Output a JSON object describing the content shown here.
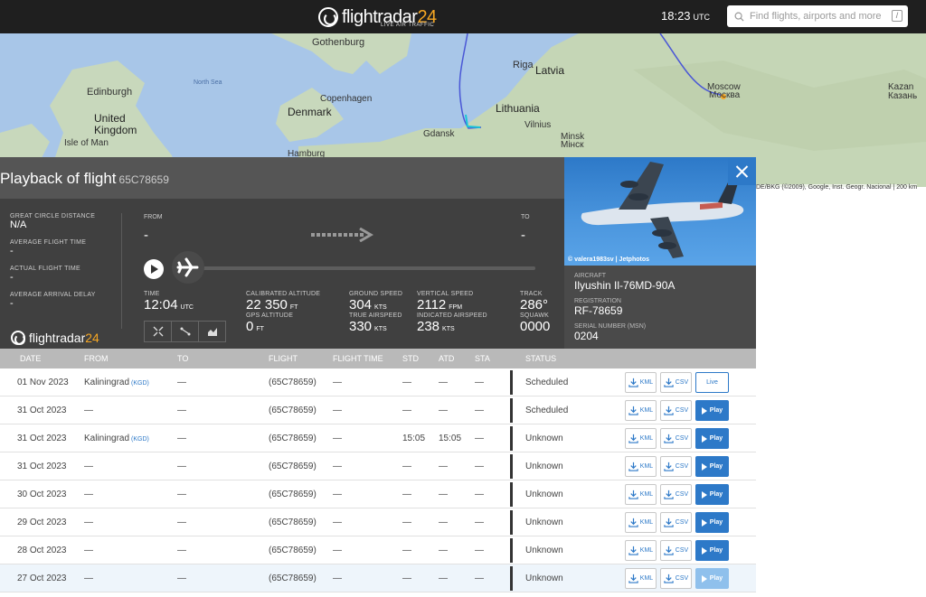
{
  "header": {
    "logo_text": "flightradar",
    "logo_num": "24",
    "logo_sub": "LIVE AIR TRAFFIC",
    "time": "18:23",
    "time_zone": "UTC",
    "search_placeholder": "Find flights, airports and more",
    "search_shortcut": "/"
  },
  "map": {
    "labels": [
      "Gothenburg",
      "Riga",
      "Latvia",
      "Edinburgh",
      "North Sea",
      "Denmark",
      "Copenhagen",
      "United Kingdom",
      "Isle of Man",
      "Lithuania",
      "Vilnius",
      "Gdansk",
      "Minsk",
      "Hamburg",
      "Moscow",
      "Москва",
      "Kazan",
      "Казань",
      "Мінск"
    ],
    "attribution": "DE/BKG (©2009), Google, Inst. Geogr. Nacional | 200 km"
  },
  "panel": {
    "title": "Playback of flight",
    "flight_id": "65C78659",
    "stats": [
      {
        "label": "GREAT CIRCLE DISTANCE",
        "value": "N/A"
      },
      {
        "label": "AVERAGE FLIGHT TIME",
        "value": "-"
      },
      {
        "label": "ACTUAL FLIGHT TIME",
        "value": "-"
      },
      {
        "label": "AVERAGE ARRIVAL DELAY",
        "value": "-"
      }
    ],
    "from_label": "FROM",
    "from_value": "-",
    "to_label": "TO",
    "to_value": "-",
    "playback_progress": 0,
    "telemetry": {
      "time_label": "TIME",
      "time_value": "12:04",
      "time_unit": "UTC",
      "cal_alt_label": "CALIBRATED ALTITUDE",
      "cal_alt_value": "22 350",
      "cal_alt_unit": "FT",
      "gps_alt_label": "GPS ALTITUDE",
      "gps_alt_value": "0",
      "gps_alt_unit": "FT",
      "gs_label": "GROUND SPEED",
      "gs_value": "304",
      "gs_unit": "KTS",
      "tas_label": "TRUE AIRSPEED",
      "tas_value": "330",
      "tas_unit": "KTS",
      "vs_label": "VERTICAL SPEED",
      "vs_value": "2112",
      "vs_unit": "FPM",
      "ias_label": "INDICATED AIRSPEED",
      "ias_value": "238",
      "ias_unit": "KTS",
      "track_label": "TRACK",
      "track_value": "286°",
      "squawk_label": "SQUAWK",
      "squawk_value": "0000"
    },
    "photo_credit": "© valera1983sv | Jetphotos",
    "aircraft_label": "AIRCRAFT",
    "aircraft_value": "Ilyushin Il-76MD-90A",
    "registration_label": "REGISTRATION",
    "registration_value": "RF-78659",
    "serial_label": "SERIAL NUMBER (MSN)",
    "serial_value": "0204"
  },
  "table": {
    "headers": [
      "DATE",
      "FROM",
      "TO",
      "FLIGHT",
      "FLIGHT TIME",
      "STD",
      "ATD",
      "STA",
      "STATUS"
    ],
    "kml_label": "KML",
    "csv_label": "CSV",
    "rows": [
      {
        "date": "01 Nov 2023",
        "from": "Kaliningrad",
        "from_iata": "(KGD)",
        "to": "—",
        "flight": "(65C78659)",
        "flight_time": "—",
        "std": "—",
        "atd": "—",
        "sta": "—",
        "status": "Scheduled",
        "action": "Live"
      },
      {
        "date": "31 Oct 2023",
        "from": "—",
        "from_iata": "",
        "to": "—",
        "flight": "(65C78659)",
        "flight_time": "—",
        "std": "—",
        "atd": "—",
        "sta": "—",
        "status": "Scheduled",
        "action": "Play"
      },
      {
        "date": "31 Oct 2023",
        "from": "Kaliningrad",
        "from_iata": "(KGD)",
        "to": "—",
        "flight": "(65C78659)",
        "flight_time": "—",
        "std": "15:05",
        "atd": "15:05",
        "sta": "—",
        "status": "Unknown",
        "action": "Play"
      },
      {
        "date": "31 Oct 2023",
        "from": "—",
        "from_iata": "",
        "to": "—",
        "flight": "(65C78659)",
        "flight_time": "—",
        "std": "—",
        "atd": "—",
        "sta": "—",
        "status": "Unknown",
        "action": "Play"
      },
      {
        "date": "30 Oct 2023",
        "from": "—",
        "from_iata": "",
        "to": "—",
        "flight": "(65C78659)",
        "flight_time": "—",
        "std": "—",
        "atd": "—",
        "sta": "—",
        "status": "Unknown",
        "action": "Play"
      },
      {
        "date": "29 Oct 2023",
        "from": "—",
        "from_iata": "",
        "to": "—",
        "flight": "(65C78659)",
        "flight_time": "—",
        "std": "—",
        "atd": "—",
        "sta": "—",
        "status": "Unknown",
        "action": "Play"
      },
      {
        "date": "28 Oct 2023",
        "from": "—",
        "from_iata": "",
        "to": "—",
        "flight": "(65C78659)",
        "flight_time": "—",
        "std": "—",
        "atd": "—",
        "sta": "—",
        "status": "Unknown",
        "action": "Play"
      },
      {
        "date": "27 Oct 2023",
        "from": "—",
        "from_iata": "",
        "to": "—",
        "flight": "(65C78659)",
        "flight_time": "—",
        "std": "—",
        "atd": "—",
        "sta": "—",
        "status": "Unknown",
        "action": "Play"
      }
    ]
  },
  "colors": {
    "accent": "#2d79c8",
    "brand_orange": "#f5a623",
    "panel": "#404040",
    "topbar": "#1f1f1f"
  }
}
